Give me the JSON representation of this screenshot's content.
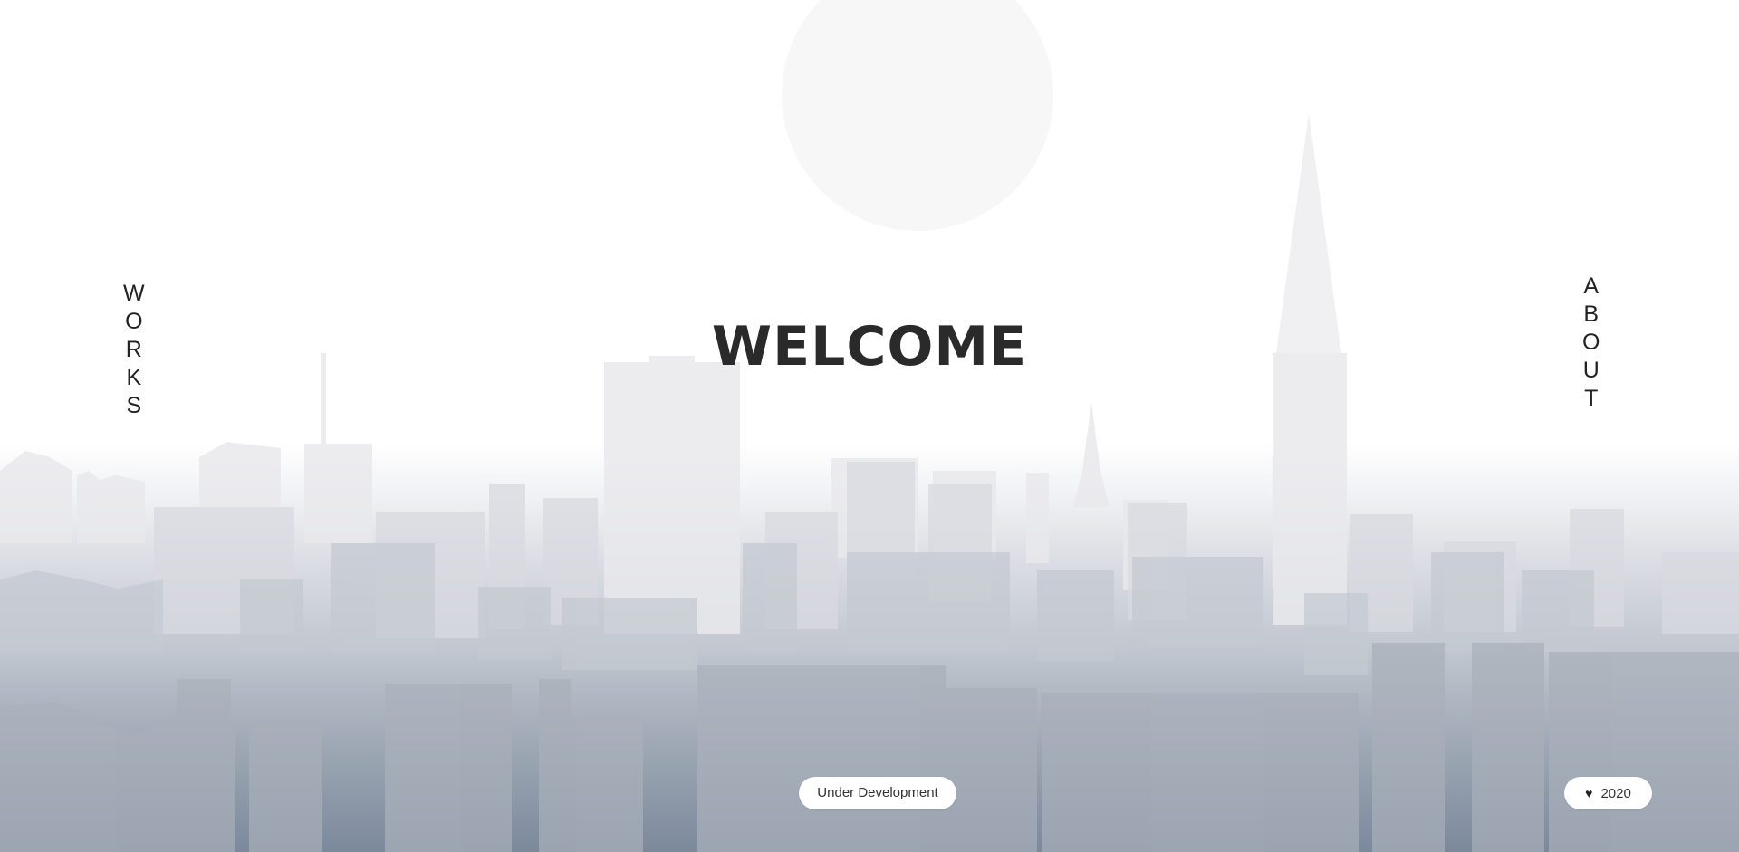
{
  "nav": {
    "works_letters": [
      "W",
      "O",
      "R",
      "K",
      "S"
    ],
    "about_letters": [
      "A",
      "B",
      "O",
      "U",
      "T"
    ]
  },
  "hero": {
    "title": "WELCOME"
  },
  "footer": {
    "status_label": "Under Development",
    "year_label": "2020",
    "heart_icon": "♥"
  },
  "colors": {
    "text": "#222222",
    "sky_top": "#ffffff",
    "ground_bottom": "#7b899b",
    "pill_bg": "#ffffff"
  }
}
